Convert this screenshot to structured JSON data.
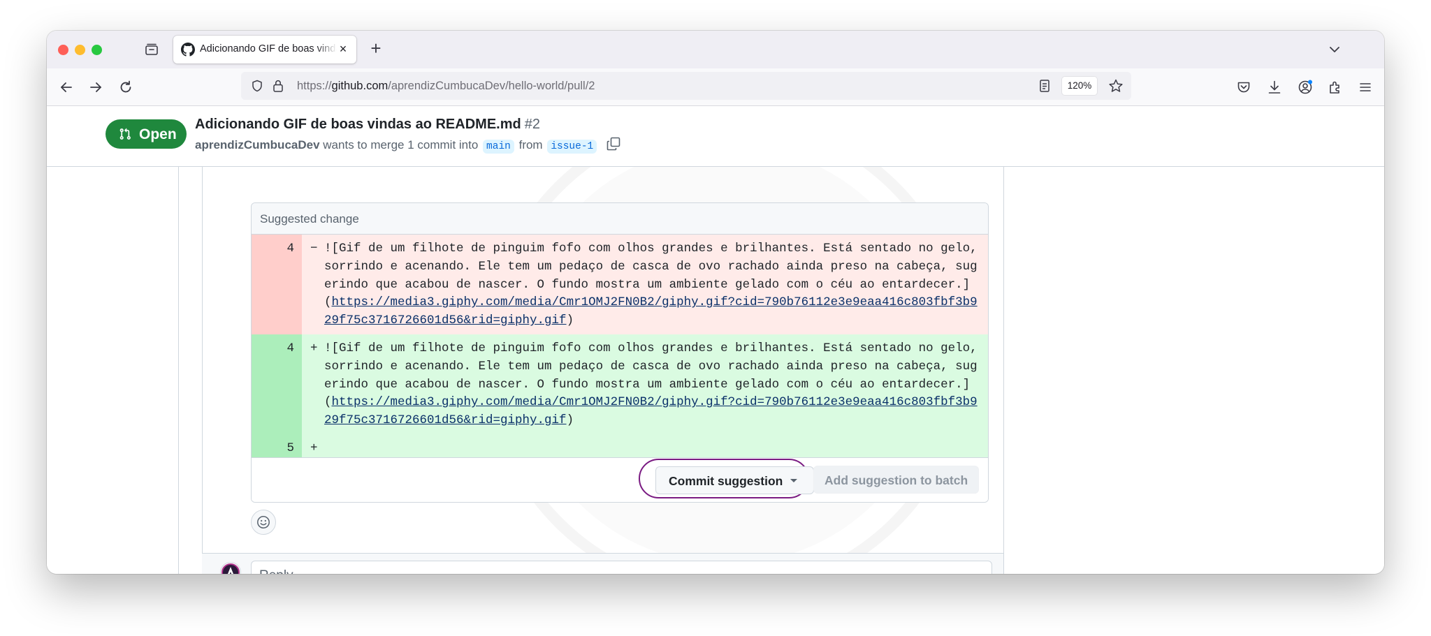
{
  "browser": {
    "tab_title": "Adicionando GIF de boas vindas ao README.md",
    "url_prefix": "https://",
    "url_host": "github.com",
    "url_path": "/aprendizCumbucaDev/hello-world/pull/2",
    "zoom": "120%"
  },
  "pr": {
    "state": "Open",
    "title": "Adicionando GIF de boas vindas ao README.md",
    "number": "#2",
    "author": "aprendizCumbucaDev",
    "merge_text": "wants to merge 1 commit into",
    "base_branch": "main",
    "from_text": "from",
    "head_branch": "issue-1"
  },
  "suggestion": {
    "header": "Suggested change",
    "removed": {
      "line_number": "4",
      "sign": "−",
      "text": "![Gif de um filhote de pinguim fofo com olhos grandes e brilhantes. Está sentado no gelo, sorrindo e acenando. Ele tem um pedaço de casca de ovo rachado ainda preso na cabeça, sugerindo que acabou de nascer. O fundo mostra um ambiente gelado com o céu ao entardecer.](",
      "link": "https://media3.giphy.com/media/Cmr1OMJ2FN0B2/giphy.gif?cid=790b76112e3e9eaa416c803fbf3b929f75c3716726601d56&rid=giphy.gif",
      "tail": ")"
    },
    "added": {
      "line_number": "4",
      "sign": "+",
      "text": "![Gif de um filhote de pinguim fofo com olhos grandes e brilhantes. Está sentado no gelo, sorrindo e acenando. Ele tem um pedaço de casca de ovo rachado ainda preso na cabeça, sugerindo que acabou de nascer. O fundo mostra um ambiente gelado com o céu ao entardecer.](",
      "link": "https://media3.giphy.com/media/Cmr1OMJ2FN0B2/giphy.gif?cid=790b76112e3e9eaa416c803fbf3b929f75c3716726601d56&rid=giphy.gif",
      "tail": ")"
    },
    "added_blank": {
      "line_number": "5",
      "sign": "+"
    },
    "commit_button": "Commit suggestion",
    "batch_button": "Add suggestion to batch"
  },
  "reply": {
    "placeholder": "Reply..."
  },
  "colors": {
    "open_green": "#1f883d",
    "highlight_ring": "#7a1b82"
  }
}
